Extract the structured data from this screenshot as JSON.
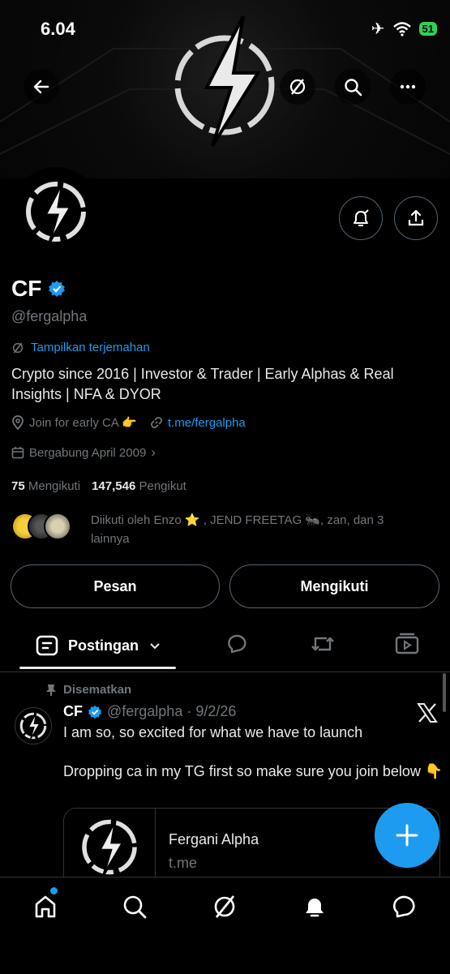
{
  "status_bar": {
    "time": "6.04",
    "battery": "51"
  },
  "profile": {
    "name": "CF",
    "handle": "@fergalpha",
    "translate_label": "Tampilkan terjemahan",
    "bio": "Crypto since 2016 | Investor & Trader | Early Alphas & Real Insights | NFA & DYOR",
    "location": "Join for early CA 👉",
    "website": "t.me/fergalpha",
    "joined": "Bergabung April 2009",
    "following_count": "75",
    "following_label": "Mengikuti",
    "followers_count": "147,546",
    "followers_label": "Pengikut",
    "followed_by": "Diikuti oleh Enzo ⭐️ , JEND FREETAG 🐜, zan, dan 3 lainnya"
  },
  "buttons": {
    "message": "Pesan",
    "following": "Mengikuti"
  },
  "tabs": {
    "posts": "Postingan"
  },
  "pinned_tweet": {
    "pinned_label": "Disematkan",
    "author": "CF",
    "handle_date": "@fergalpha · 9/2/26",
    "text_line1": "I am so, so excited for what we have to launch",
    "text_line2": "Dropping ca in my TG first so make sure you join below 👇",
    "card_title": "Fergani Alpha",
    "card_domain": "t.me"
  },
  "colors": {
    "accent": "#1d9bf0",
    "background": "#000000",
    "muted": "#71767b"
  }
}
